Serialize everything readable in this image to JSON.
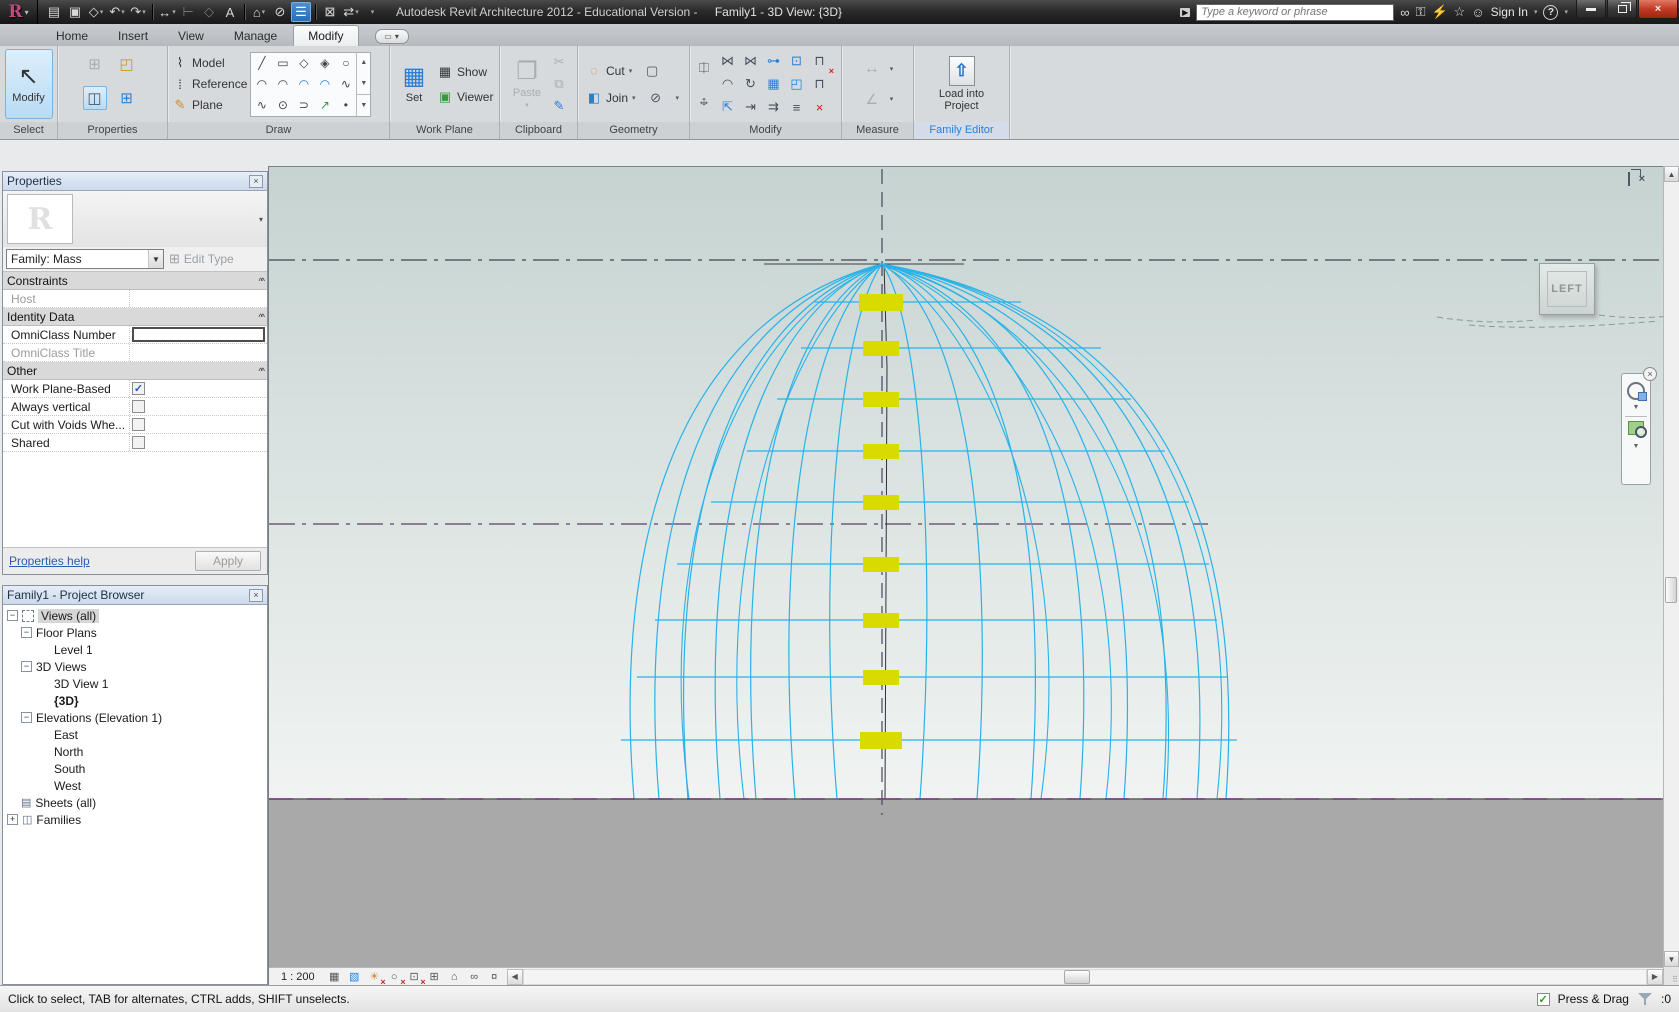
{
  "titlebar": {
    "title": "Autodesk Revit Architecture 2012 - Educational Version -",
    "document_title": "Family1 - 3D View: {3D}",
    "search_placeholder": "Type a keyword or phrase",
    "sign_in_label": "Sign In"
  },
  "tabs": [
    {
      "label": "Home"
    },
    {
      "label": "Insert"
    },
    {
      "label": "View"
    },
    {
      "label": "Manage"
    },
    {
      "label": "Modify"
    }
  ],
  "ribbon": {
    "select_panel": {
      "label": "Select",
      "modify_button": "Modify"
    },
    "properties_panel": {
      "label": "Properties"
    },
    "draw_panel": {
      "label": "Draw",
      "model": "Model",
      "reference": "Reference",
      "plane": "Plane"
    },
    "work_plane_panel": {
      "label": "Work Plane",
      "set": "Set",
      "show": "Show",
      "viewer": "Viewer"
    },
    "clipboard_panel": {
      "label": "Clipboard",
      "paste": "Paste"
    },
    "geometry_panel": {
      "label": "Geometry",
      "cut": "Cut",
      "join": "Join"
    },
    "modify_panel": {
      "label": "Modify"
    },
    "measure_panel": {
      "label": "Measure"
    },
    "family_editor_panel": {
      "label": "Family Editor",
      "load_button": "Load into Project"
    }
  },
  "properties_palette": {
    "title": "Properties",
    "type_selector": "Family: Mass",
    "edit_type_label": "Edit Type",
    "group_constraints": "Constraints",
    "row_host": "Host",
    "group_identity": "Identity Data",
    "row_omniclass_number": "OmniClass Number",
    "row_omniclass_title": "OmniClass Title",
    "group_other": "Other",
    "row_work_plane_based": "Work Plane-Based",
    "row_always_vertical": "Always vertical",
    "row_cut_with_voids": "Cut with Voids Whe...",
    "row_shared": "Shared",
    "help_link": "Properties help",
    "apply_label": "Apply"
  },
  "project_browser": {
    "title": "Family1 - Project Browser",
    "nodes": [
      {
        "label": "Views (all)"
      },
      {
        "label": "Floor Plans"
      },
      {
        "label": "Level 1"
      },
      {
        "label": "3D Views"
      },
      {
        "label": "3D View 1"
      },
      {
        "label": "{3D}"
      },
      {
        "label": "Elevations (Elevation 1)"
      },
      {
        "label": "East"
      },
      {
        "label": "North"
      },
      {
        "label": "South"
      },
      {
        "label": "West"
      },
      {
        "label": "Sheets (all)"
      },
      {
        "label": "Families"
      }
    ]
  },
  "viewport": {
    "viewcube_label": "LEFT",
    "scale_label": "1 : 200"
  },
  "statusbar": {
    "message": "Click to select, TAB for alternates, CTRL adds, SHIFT unselects.",
    "press_drag_label": "Press & Drag",
    "filter_count": ":0"
  },
  "colors": {
    "wireframe_cyan": "#29b2e8",
    "handle_yellow": "#d8da00",
    "selection_blue": "#b9dbf4",
    "close_red": "#c23a23"
  }
}
